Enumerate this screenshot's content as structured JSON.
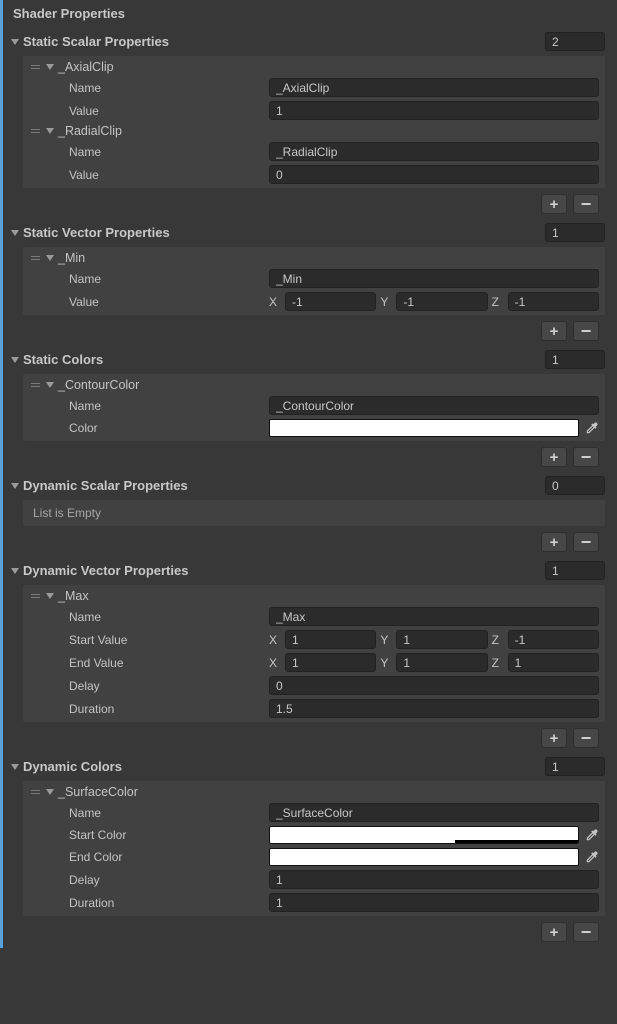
{
  "header": {
    "title": "Shader Properties"
  },
  "sections": {
    "staticScalar": {
      "title": "Static Scalar Properties",
      "count": "2",
      "items": [
        {
          "title": "_AxialClip",
          "nameLabel": "Name",
          "nameValue": "_AxialClip",
          "valueLabel": "Value",
          "value": "1"
        },
        {
          "title": "_RadialClip",
          "nameLabel": "Name",
          "nameValue": "_RadialClip",
          "valueLabel": "Value",
          "value": "0"
        }
      ]
    },
    "staticVector": {
      "title": "Static Vector Properties",
      "count": "1",
      "items": [
        {
          "title": "_Min",
          "nameLabel": "Name",
          "nameValue": "_Min",
          "valueLabel": "Value",
          "xLabel": "X",
          "yLabel": "Y",
          "zLabel": "Z",
          "x": "-1",
          "y": "-1",
          "z": "-1"
        }
      ]
    },
    "staticColors": {
      "title": "Static Colors",
      "count": "1",
      "items": [
        {
          "title": "_ContourColor",
          "nameLabel": "Name",
          "nameValue": "_ContourColor",
          "colorLabel": "Color",
          "colorHex": "#ffffff",
          "alpha": 100
        }
      ]
    },
    "dynamicScalar": {
      "title": "Dynamic Scalar Properties",
      "count": "0",
      "emptyText": "List is Empty"
    },
    "dynamicVector": {
      "title": "Dynamic Vector Properties",
      "count": "1",
      "items": [
        {
          "title": "_Max",
          "nameLabel": "Name",
          "nameValue": "_Max",
          "startLabel": "Start Value",
          "endLabel": "End Value",
          "xLabel": "X",
          "yLabel": "Y",
          "zLabel": "Z",
          "sx": "1",
          "sy": "1",
          "sz": "-1",
          "ex": "1",
          "ey": "1",
          "ez": "1",
          "delayLabel": "Delay",
          "delay": "0",
          "durationLabel": "Duration",
          "duration": "1.5"
        }
      ]
    },
    "dynamicColors": {
      "title": "Dynamic Colors",
      "count": "1",
      "items": [
        {
          "title": "_SurfaceColor",
          "nameLabel": "Name",
          "nameValue": "_SurfaceColor",
          "startColorLabel": "Start Color",
          "startColorHex": "#ffffff",
          "startAlpha": 60,
          "endColorLabel": "End Color",
          "endColorHex": "#ffffff",
          "endAlpha": 100,
          "delayLabel": "Delay",
          "delay": "1",
          "durationLabel": "Duration",
          "duration": "1"
        }
      ]
    }
  },
  "buttons": {
    "plus": "+",
    "minus": "−"
  }
}
